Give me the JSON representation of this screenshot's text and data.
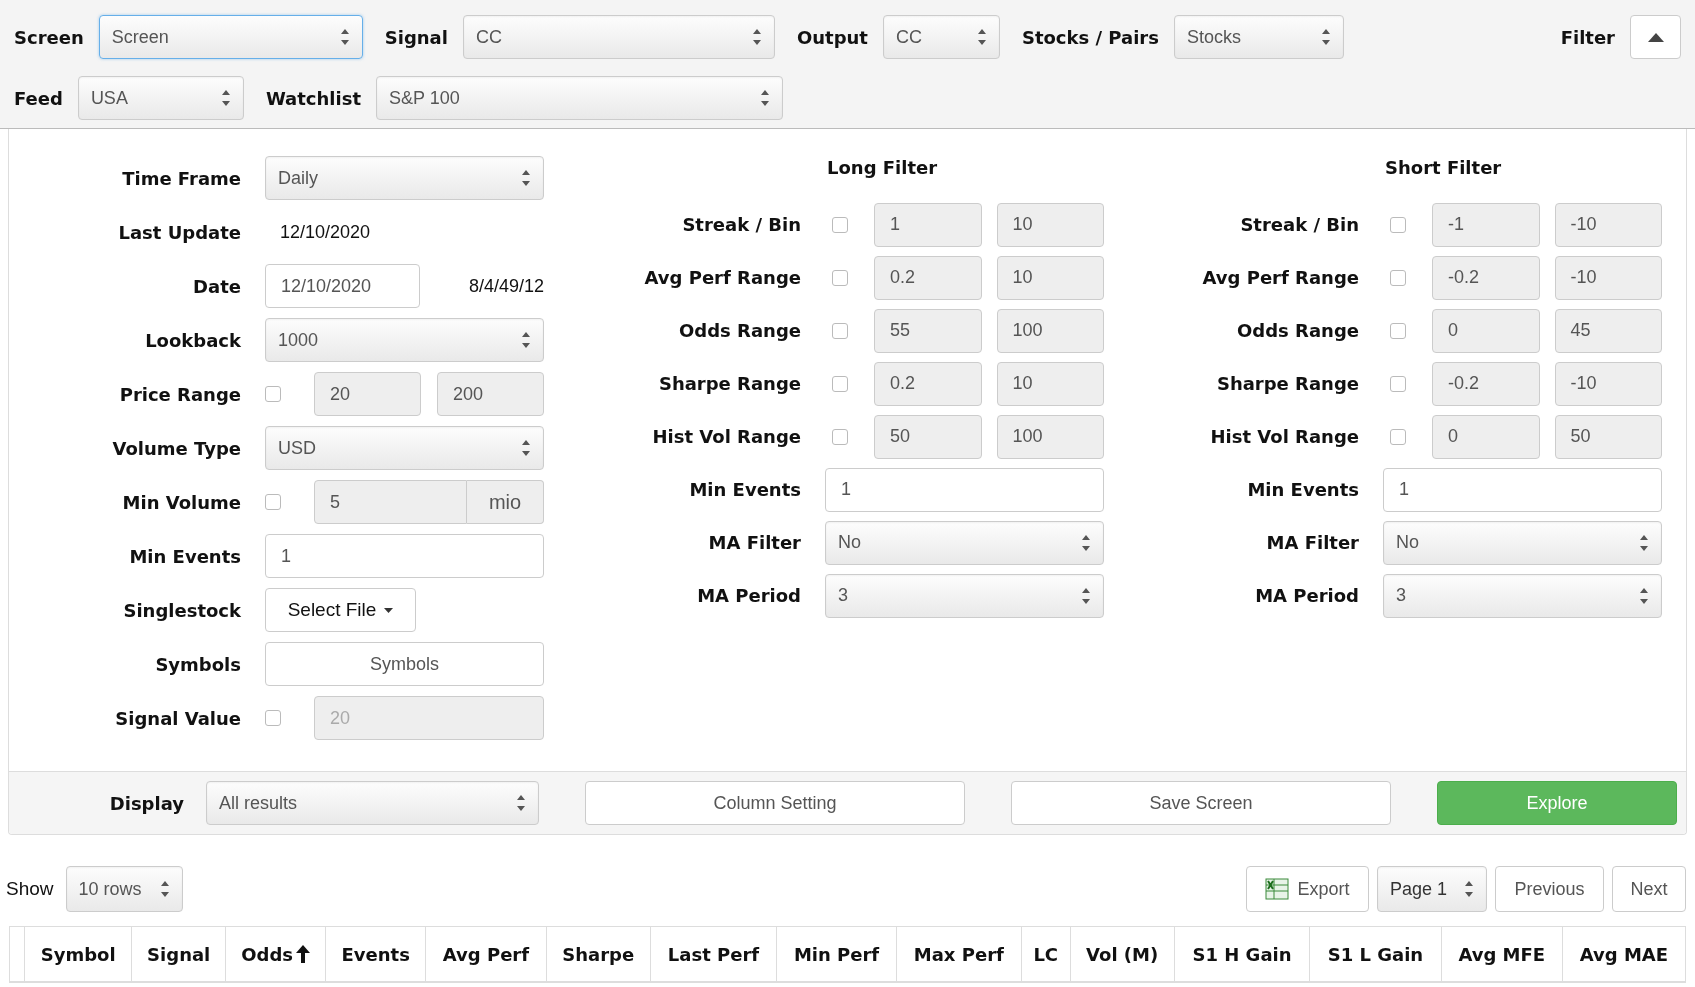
{
  "toolbar": {
    "row_1": [
      {
        "label": "Screen",
        "value": "Screen",
        "focused": true
      },
      {
        "label": "Signal",
        "value": "CC",
        "focused": false
      },
      {
        "label": "Output",
        "value": "CC",
        "focused": false
      },
      {
        "label": "Stocks / Pairs",
        "value": "Stocks",
        "focused": false
      }
    ],
    "filter": {
      "label": "Filter",
      "expanded": true
    },
    "row_2": [
      {
        "label": "Feed",
        "value": "USA",
        "focused": false
      },
      {
        "label": "Watchlist",
        "value": "S&P 100",
        "focused": false
      }
    ]
  },
  "settings": [
    {
      "label": "Time Frame",
      "kind": "select",
      "value": "Daily"
    },
    {
      "label": "Last Update",
      "kind": "text",
      "value": "12/10/2020"
    },
    {
      "label": "Date",
      "kind": "date",
      "value": "12/10/2020",
      "note": "8/4/49/12"
    },
    {
      "label": "Lookback",
      "kind": "select",
      "value": "1000"
    },
    {
      "label": "Price Range",
      "kind": "range",
      "checked": false,
      "min": "20",
      "max": "200"
    },
    {
      "label": "Volume Type",
      "kind": "select",
      "value": "USD"
    },
    {
      "label": "Min Volume",
      "kind": "addon",
      "checked": false,
      "value": "5",
      "unit": "mio"
    },
    {
      "label": "Min Events",
      "kind": "input",
      "value": "1"
    },
    {
      "label": "Singlestock",
      "kind": "dropdown_button",
      "value": "Select File"
    },
    {
      "label": "Symbols",
      "kind": "button",
      "value": "Symbols"
    },
    {
      "label": "Signal Value",
      "kind": "single",
      "checked": false,
      "placeholder": "20"
    }
  ],
  "long_filter": {
    "title": "Long Filter",
    "rows": [
      {
        "label": "Streak / Bin",
        "kind": "range",
        "checked": false,
        "min": "1",
        "max": "10"
      },
      {
        "label": "Avg Perf Range",
        "kind": "range",
        "checked": false,
        "min": "0.2",
        "max": "10"
      },
      {
        "label": "Odds Range",
        "kind": "range",
        "checked": false,
        "min": "55",
        "max": "100"
      },
      {
        "label": "Sharpe Range",
        "kind": "range",
        "checked": false,
        "min": "0.2",
        "max": "10"
      },
      {
        "label": "Hist Vol Range",
        "kind": "range",
        "checked": false,
        "min": "50",
        "max": "100"
      },
      {
        "label": "Min Events",
        "kind": "input",
        "value": "1"
      },
      {
        "label": "MA Filter",
        "kind": "select",
        "value": "No"
      },
      {
        "label": "MA Period",
        "kind": "select",
        "value": "3"
      }
    ]
  },
  "short_filter": {
    "title": "Short Filter",
    "rows": [
      {
        "label": "Streak / Bin",
        "kind": "range",
        "checked": false,
        "min": "-1",
        "max": "-10"
      },
      {
        "label": "Avg Perf Range",
        "kind": "range",
        "checked": false,
        "min": "-0.2",
        "max": "-10"
      },
      {
        "label": "Odds Range",
        "kind": "range",
        "checked": false,
        "min": "0",
        "max": "45"
      },
      {
        "label": "Sharpe Range",
        "kind": "range",
        "checked": false,
        "min": "-0.2",
        "max": "-10"
      },
      {
        "label": "Hist Vol Range",
        "kind": "range",
        "checked": false,
        "min": "0",
        "max": "50"
      },
      {
        "label": "Min Events",
        "kind": "input",
        "value": "1"
      },
      {
        "label": "MA Filter",
        "kind": "select",
        "value": "No"
      },
      {
        "label": "MA Period",
        "kind": "select",
        "value": "3"
      }
    ]
  },
  "display": {
    "label": "Display",
    "value": "All results"
  },
  "actions": [
    {
      "label": "Column Setting",
      "kind": "default"
    },
    {
      "label": "Save Screen",
      "kind": "default"
    },
    {
      "label": "Explore",
      "kind": "primary"
    }
  ],
  "pager": {
    "show_label": "Show",
    "rows": "10 rows",
    "export": "Export",
    "page": "Page 1",
    "previous": "Previous",
    "next": "Next"
  },
  "table": {
    "columns": [
      {
        "label": "Symbol",
        "sorted": false
      },
      {
        "label": "Signal",
        "sorted": false
      },
      {
        "label": "Odds",
        "sorted": true
      },
      {
        "label": "Events",
        "sorted": false
      },
      {
        "label": "Avg Perf",
        "sorted": false
      },
      {
        "label": "Sharpe",
        "sorted": false
      },
      {
        "label": "Last Perf",
        "sorted": false
      },
      {
        "label": "Min Perf",
        "sorted": false
      },
      {
        "label": "Max Perf",
        "sorted": false
      },
      {
        "label": "LC",
        "sorted": false
      },
      {
        "label": "Vol (M)",
        "sorted": false
      },
      {
        "label": "S1 H Gain",
        "sorted": false
      },
      {
        "label": "S1 L Gain",
        "sorted": false
      },
      {
        "label": "Avg MFE",
        "sorted": false
      },
      {
        "label": "Avg MAE",
        "sorted": false
      }
    ]
  }
}
